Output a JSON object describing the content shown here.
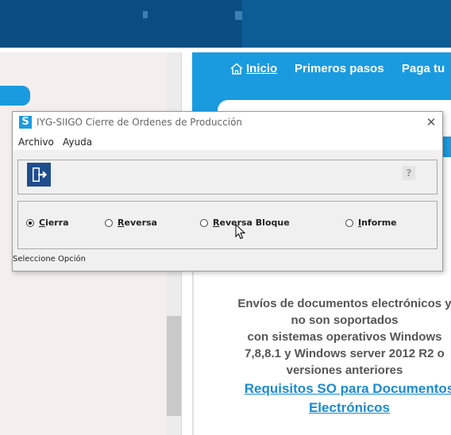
{
  "background": {
    "nav": {
      "home_label": "Inicio",
      "first_steps_label": "Primeros pasos",
      "pay_label": "Paga tu"
    },
    "notice_lines": [
      "Envíos de documentos electrónicos y",
      "no son soportados",
      "con sistemas operativos Windows",
      "7,8,8.1 y Windows server 2012 R2 o",
      "versiones anteriores"
    ],
    "link_lines": [
      "Requisitos SO para Documentos",
      "Electrónicos"
    ]
  },
  "dialog": {
    "title": "IYG-SIIGO Cierre de Ordenes de Producción",
    "logo_letter": "S",
    "close_glyph": "✕",
    "menu": [
      "Archivo",
      "Ayuda"
    ],
    "help_label": "?",
    "options": [
      {
        "first": "C",
        "rest": "ierra",
        "checked": true
      },
      {
        "first": "R",
        "rest": "eversa",
        "checked": false
      },
      {
        "first": "R",
        "rest": "eversa Bloque",
        "checked": false
      },
      {
        "first": "I",
        "rest": "nforme",
        "checked": false
      }
    ],
    "status": "Seleccione Opción"
  },
  "icons": {
    "home": "home-icon",
    "exit": "exit-door-icon",
    "cursor": "mouse-pointer-icon"
  },
  "colors": {
    "header_blue": "#1a9be0",
    "exit_button": "#1f4e8c",
    "link": "#1a8bd0"
  }
}
